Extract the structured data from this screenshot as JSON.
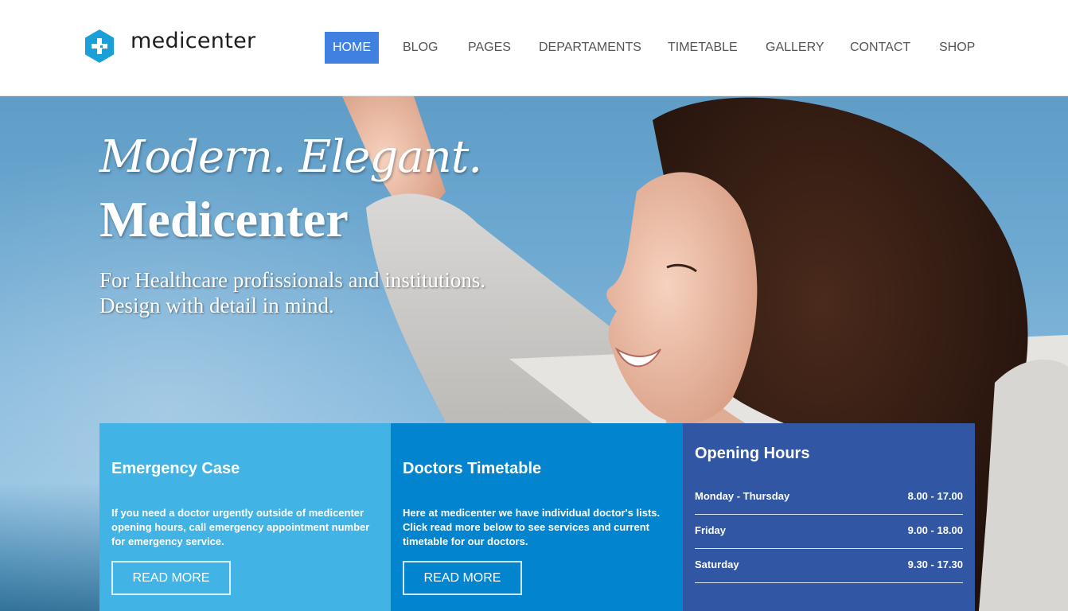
{
  "logo": {
    "text": "medicenter"
  },
  "nav": {
    "items": [
      {
        "label": "HOME",
        "active": true
      },
      {
        "label": "BLOG",
        "active": false
      },
      {
        "label": "PAGES",
        "active": false
      },
      {
        "label": "DEPARTAMENTS",
        "active": false
      },
      {
        "label": "TIMETABLE",
        "active": false
      },
      {
        "label": "GALLERY",
        "active": false
      },
      {
        "label": "CONTACT",
        "active": false
      },
      {
        "label": "SHOP",
        "active": false
      }
    ]
  },
  "hero": {
    "line1": "Modern. Elegant.",
    "line2": "Medicenter",
    "subline1": "For Healthcare profissionals and institutions.",
    "subline2": "Design with detail in mind."
  },
  "emergency": {
    "title": "Emergency Case",
    "text": "If you need a doctor urgently outside of medicenter opening hours, call emergency appointment number for emergency service.",
    "button": "READ MORE"
  },
  "timetable": {
    "title": "Doctors Timetable",
    "text": "Here at medicenter we have individual doctor's lists. Click read more below to see services and current timetable for our doctors.",
    "button": "READ MORE"
  },
  "hours": {
    "title": "Opening Hours",
    "rows": [
      {
        "day": "Monday - Thursday",
        "time": "8.00 - 17.00"
      },
      {
        "day": "Friday",
        "time": "9.00 - 18.00"
      },
      {
        "day": "Saturday",
        "time": "9.30 - 17.30"
      }
    ]
  },
  "colors": {
    "nav_active": "#3f80e0",
    "logo": "#1a9fd9",
    "box_emergency": "#42b3e5",
    "box_timetable": "#0384ce",
    "box_hours": "#3156a3"
  }
}
